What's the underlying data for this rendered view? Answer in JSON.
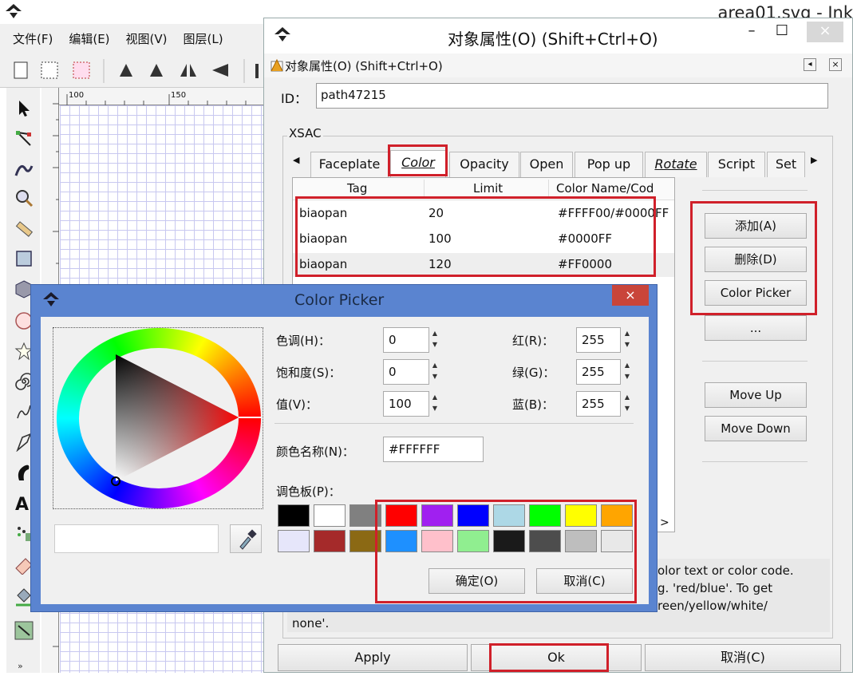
{
  "inkscape": {
    "window_title": "area01.svg - Ink",
    "menu": [
      "文件(F)",
      "编辑(E)",
      "视图(V)",
      "图层(L)"
    ],
    "ruler_marks": [
      "100",
      "150"
    ],
    "blue_color": "#2a3df0"
  },
  "props": {
    "title": "对象属性(O) (Shift+Ctrl+O)",
    "subtitle": "对象属性(O) (Shift+Ctrl+O)",
    "id_label": "ID：",
    "id_value": "path47215",
    "group_label": "XSAC",
    "tabs": [
      "Faceplate",
      "Color",
      "Opacity",
      "Open",
      "Pop up",
      "Rotate",
      "Script",
      "Set"
    ],
    "active_tab": "Color",
    "columns": [
      "Tag",
      "Limit",
      "Color Name/Cod"
    ],
    "rows": [
      {
        "tag": "biaopan",
        "limit": "20",
        "color": "#FFFF00/#0000FF"
      },
      {
        "tag": "biaopan",
        "limit": "100",
        "color": "#0000FF"
      },
      {
        "tag": "biaopan",
        "limit": "120",
        "color": "#FF0000"
      }
    ],
    "side_buttons": [
      "添加(A)",
      "删除(D)",
      "Color Picker",
      "...",
      "Move Up",
      "Move Down"
    ],
    "help_lines": [
      "olor text or color code.",
      "g. 'red/blue'. To get",
      "reen/yellow/white/",
      "none'."
    ],
    "bottom_buttons": [
      "Apply",
      "Ok",
      "取消(C)"
    ],
    "scroll_arrow": ">"
  },
  "picker": {
    "title": "Color Picker",
    "close": "×",
    "hsv": [
      {
        "label": "色调(H)：",
        "value": "0"
      },
      {
        "label": "饱和度(S)：",
        "value": "0"
      },
      {
        "label": "值(V)：",
        "value": "100"
      }
    ],
    "rgb": [
      {
        "label": "红(R)：",
        "value": "255"
      },
      {
        "label": "绿(G)：",
        "value": "255"
      },
      {
        "label": "蓝(B)：",
        "value": "255"
      }
    ],
    "name_label": "颜色名称(N)：",
    "name_value": "#FFFFFF",
    "palette_label": "调色板(P)：",
    "palette": [
      "#000000",
      "#FFFFFF",
      "#808080",
      "#FF0000",
      "#A020F0",
      "#0000FF",
      "#ADD8E6",
      "#00FF00",
      "#FFFF00",
      "#FFA500",
      "#E6E6FA",
      "#A52A2A",
      "#8B6914",
      "#1E90FF",
      "#FFC0CB",
      "#90EE90",
      "#1A1A1A",
      "#4D4D4D",
      "#BEBEBE",
      "#E8E8E8"
    ],
    "ok": "确定(O)",
    "cancel": "取消(C)"
  }
}
